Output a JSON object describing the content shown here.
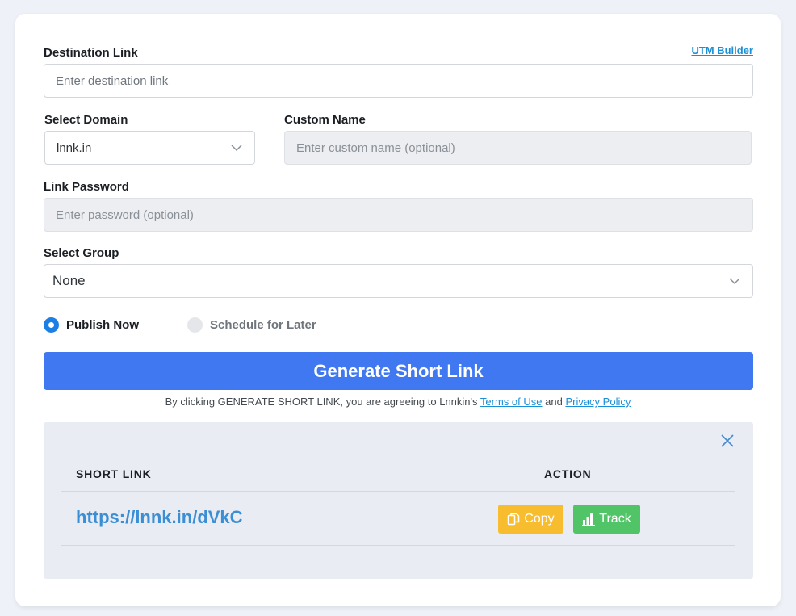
{
  "form": {
    "destination_label": "Destination Link",
    "utm_builder": "UTM Builder",
    "destination_placeholder": "Enter destination link",
    "domain_label": "Select Domain",
    "domain_value": "lnnk.in",
    "custom_name_label": "Custom Name",
    "custom_name_placeholder": "Enter custom name (optional)",
    "password_label": "Link Password",
    "password_placeholder": "Enter password (optional)",
    "group_label": "Select Group",
    "group_value": "None",
    "publish_now": "Publish Now",
    "schedule_later": "Schedule for Later",
    "publish_selected": "Publish Now",
    "generate_button": "Generate Short Link"
  },
  "terms": {
    "prefix": "By clicking GENERATE SHORT LINK, you are agreeing to Lnnkin's",
    "terms_link": "Terms of Use",
    "and": "and",
    "privacy_link": "Privacy Policy"
  },
  "result": {
    "col_short_link": "SHORT LINK",
    "col_action": "ACTION",
    "short_url": "https://lnnk.in/dVkC",
    "copy_label": "Copy",
    "track_label": "Track"
  },
  "icons": {
    "close": "close-icon",
    "copy": "copy-icon",
    "track": "bar-chart-icon",
    "dropdown": "chevron-down-icon"
  },
  "colors": {
    "primary": "#4078f2",
    "link": "#1a8fd6",
    "copy_button": "#f7bd2e",
    "track_button": "#52c468",
    "radio_active": "#1c7fe6"
  }
}
